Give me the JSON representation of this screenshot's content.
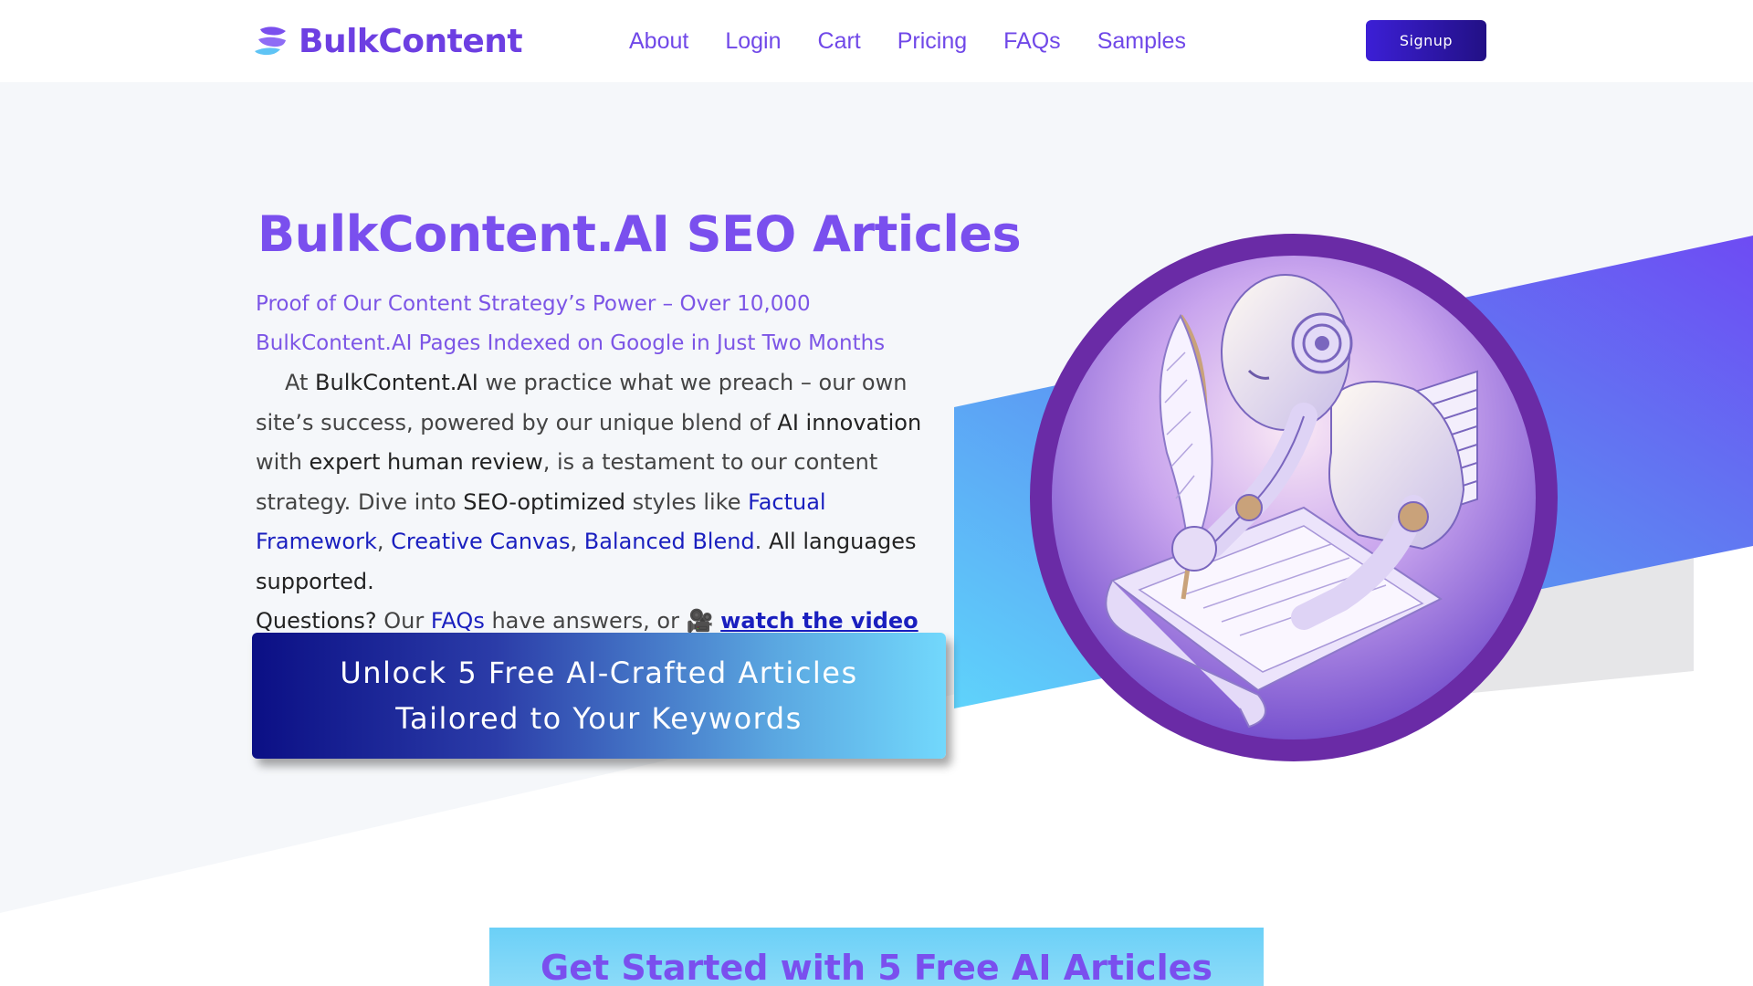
{
  "brand": {
    "name": "BulkContent",
    "color": "#6d3fe2"
  },
  "nav": {
    "items": [
      {
        "label": "About"
      },
      {
        "label": "Login"
      },
      {
        "label": "Cart"
      },
      {
        "label": "Pricing"
      },
      {
        "label": "FAQs"
      },
      {
        "label": "Samples"
      }
    ],
    "signup_label": "Signup"
  },
  "hero": {
    "title": "BulkContent.AI SEO Articles",
    "subtitle": "Proof of Our Content Strategy’s Power – Over 10,000 BulkContent.AI Pages Indexed on Google in Just Two Months",
    "body": {
      "t1": "At ",
      "brand": "BulkContent.AI",
      "t2": " we practice what we preach – our own site’s success, powered by our unique blend of ",
      "ai": "AI innovation",
      "t3": " with ",
      "expert": "expert human review",
      "t4": ", is a testament to our content strategy. Dive into ",
      "seo": "SEO-optimized",
      "t5": " styles like ",
      "style1": "Factual Framework",
      "t6": ", ",
      "style2": "Creative Canvas",
      "t7": ", ",
      "style3": "Balanced Blend",
      "t8": ". ",
      "languages": "All languages supported.",
      "questions": "Questions?",
      "t9": " Our ",
      "faqs": "FAQs",
      "t10": " have answers, or ",
      "video_icon": "🎥",
      "video_link": "watch the video"
    },
    "cta_line1": "Unlock 5 Free AI-Crafted Articles",
    "cta_line2": "Tailored to Your Keywords",
    "image_icon": "robot-writing-with-quill-illustration"
  },
  "banner": {
    "title": "Get Started with 5 Free AI Articles"
  },
  "colors": {
    "accent": "#7a4fee",
    "link": "#1a1fbf",
    "cta_start": "#0b0f85",
    "cta_end": "#72d8fc"
  }
}
